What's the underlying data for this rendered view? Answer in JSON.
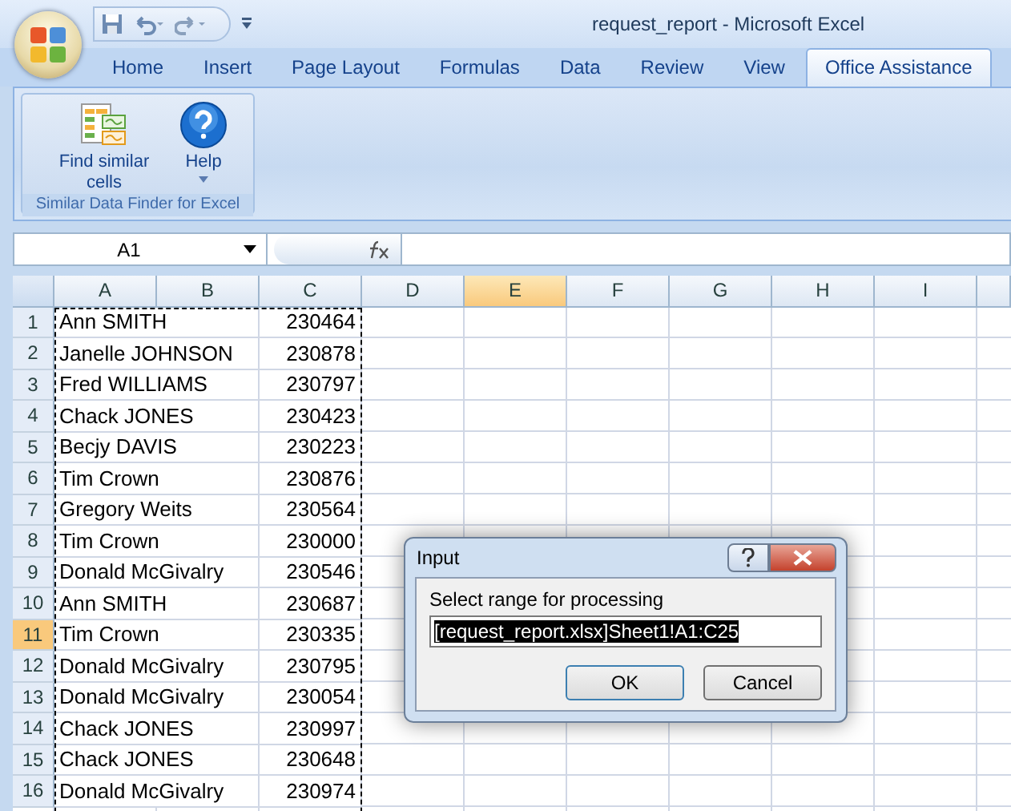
{
  "window": {
    "title": "request_report - Microsoft Excel"
  },
  "tabs": [
    {
      "label": "Home",
      "selected": false
    },
    {
      "label": "Insert",
      "selected": false
    },
    {
      "label": "Page Layout",
      "selected": false
    },
    {
      "label": "Formulas",
      "selected": false
    },
    {
      "label": "Data",
      "selected": false
    },
    {
      "label": "Review",
      "selected": false
    },
    {
      "label": "View",
      "selected": false
    },
    {
      "label": "Office Assistance",
      "selected": true
    }
  ],
  "ribbon": {
    "group_label": "Similar Data Finder for Excel",
    "buttons": [
      {
        "kind": "find",
        "label": "Find similar cells",
        "dropdown": false
      },
      {
        "kind": "help",
        "label": "Help",
        "dropdown": true
      }
    ]
  },
  "formula_bar": {
    "name_box": "A1"
  },
  "columns": [
    {
      "label": "A",
      "selected": false
    },
    {
      "label": "B",
      "selected": false
    },
    {
      "label": "C",
      "selected": false
    },
    {
      "label": "D",
      "selected": false
    },
    {
      "label": "E",
      "selected": true
    },
    {
      "label": "F",
      "selected": false
    },
    {
      "label": "G",
      "selected": false
    },
    {
      "label": "H",
      "selected": false
    },
    {
      "label": "I",
      "selected": false
    }
  ],
  "rows": [
    {
      "number": "1",
      "selected": false,
      "name": "Ann SMITH",
      "value": "230464"
    },
    {
      "number": "2",
      "selected": false,
      "name": "Janelle JOHNSON",
      "value": "230878"
    },
    {
      "number": "3",
      "selected": false,
      "name": "Fred WILLIAMS",
      "value": "230797"
    },
    {
      "number": "4",
      "selected": false,
      "name": "Chack JONES",
      "value": "230423"
    },
    {
      "number": "5",
      "selected": false,
      "name": "Becjy DAVIS",
      "value": "230223"
    },
    {
      "number": "6",
      "selected": false,
      "name": "Tim Crown",
      "value": "230876"
    },
    {
      "number": "7",
      "selected": false,
      "name": "Gregory Weits",
      "value": "230564"
    },
    {
      "number": "8",
      "selected": false,
      "name": "Tim Crown",
      "value": "230000"
    },
    {
      "number": "9",
      "selected": false,
      "name": "Donald McGivalry",
      "value": "230546"
    },
    {
      "number": "10",
      "selected": false,
      "name": "Ann SMITH",
      "value": "230687"
    },
    {
      "number": "11",
      "selected": true,
      "name": "Tim Crown",
      "value": "230335"
    },
    {
      "number": "12",
      "selected": false,
      "name": "Donald McGivalry",
      "value": "230795"
    },
    {
      "number": "13",
      "selected": false,
      "name": "Donald McGivalry",
      "value": "230054"
    },
    {
      "number": "14",
      "selected": false,
      "name": "Chack JONES",
      "value": "230997"
    },
    {
      "number": "15",
      "selected": false,
      "name": "Chack JONES",
      "value": "230648"
    },
    {
      "number": "16",
      "selected": false,
      "name": "Donald McGivalry",
      "value": "230974"
    }
  ],
  "dialog": {
    "title": "Input",
    "prompt": "Select range for processing",
    "value": "[request_report.xlsx]Sheet1!A1:C25",
    "value_selected": true,
    "buttons": [
      {
        "label": "OK",
        "default": true
      },
      {
        "label": "Cancel",
        "default": false
      }
    ]
  }
}
